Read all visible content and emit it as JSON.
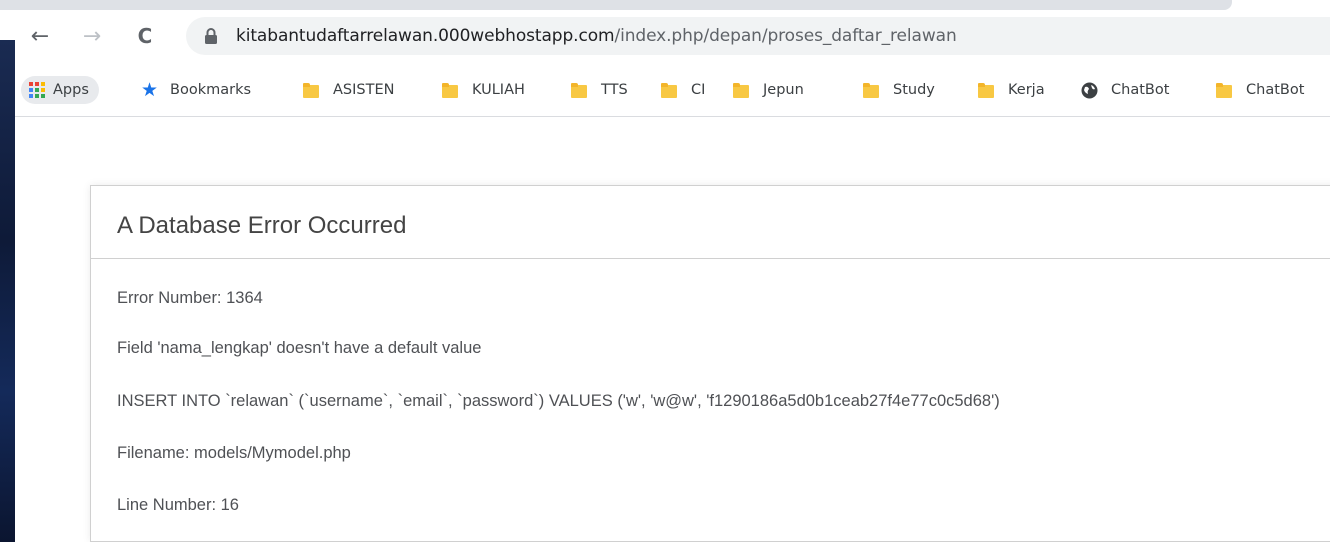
{
  "browser": {
    "url_host": "kitabantudaftarrelawan.000webhostapp.com",
    "url_path": "/index.php/depan/proses_daftar_relawan",
    "nav": {
      "back_icon": "←",
      "forward_icon": "→",
      "reload_icon": "C"
    }
  },
  "bookmarks": {
    "apps_label": "Apps",
    "items": [
      {
        "label": "Bookmarks",
        "icon": "star-icon"
      },
      {
        "label": "ASISTEN",
        "icon": "folder-icon"
      },
      {
        "label": "KULIAH",
        "icon": "folder-icon"
      },
      {
        "label": "TTS",
        "icon": "folder-icon"
      },
      {
        "label": "CI",
        "icon": "folder-icon"
      },
      {
        "label": "Jepun",
        "icon": "folder-icon"
      },
      {
        "label": "Study",
        "icon": "folder-icon"
      },
      {
        "label": "Kerja",
        "icon": "folder-icon"
      },
      {
        "label": "ChatBot",
        "icon": "globe-icon"
      },
      {
        "label": "ChatBot",
        "icon": "folder-icon"
      }
    ]
  },
  "error": {
    "title": "A Database Error Occurred",
    "lines": [
      "Error Number: 1364",
      "Field 'nama_lengkap' doesn't have a default value",
      "INSERT INTO `relawan` (`username`, `email`, `password`) VALUES ('w', 'w@w', 'f1290186a5d0b1ceab27f4e77c0c5d68')",
      "Filename: models/Mymodel.php",
      "Line Number: 16"
    ]
  },
  "colors": {
    "star": "#1a73e8",
    "folder": "#f8c843",
    "apps_grid": [
      "#ea4335",
      "#fbbc04",
      "#34a853",
      "#4285f4"
    ]
  }
}
